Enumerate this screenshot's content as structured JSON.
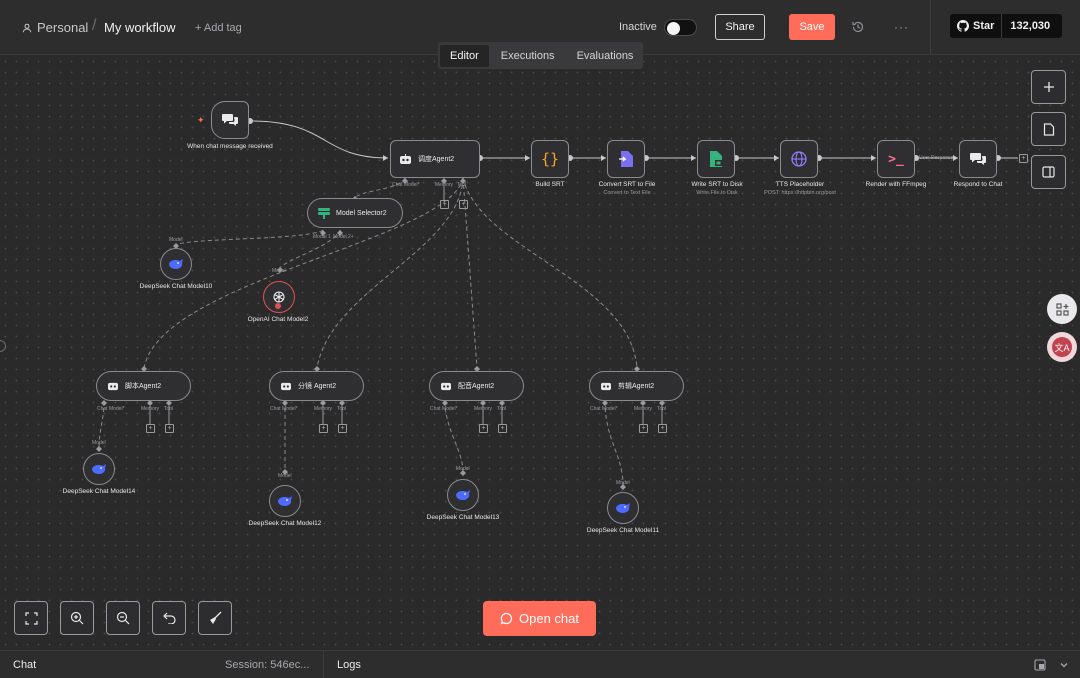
{
  "header": {
    "project": "Personal",
    "separator": "/",
    "workflow_name": "My workflow",
    "add_tag": "+ Add tag",
    "status_label": "Inactive",
    "share_label": "Share",
    "save_label": "Save",
    "more_label": "···",
    "github": {
      "star_label": "Star",
      "star_count": "132,030"
    }
  },
  "tabs": [
    {
      "label": "Editor",
      "active": true
    },
    {
      "label": "Executions",
      "active": false
    },
    {
      "label": "Evaluations",
      "active": false
    }
  ],
  "nodes": {
    "trigger": {
      "label": "When chat message received"
    },
    "main_agent": {
      "label": "调度Agent2",
      "ports": [
        "Chat Model*",
        "Memory",
        "Tool"
      ]
    },
    "build_srt": {
      "label": "Build SRT"
    },
    "convert": {
      "label": "Convert SRT to File",
      "sub": "Convert to Text File"
    },
    "write": {
      "label": "Write SRT to Disk",
      "sub": "Write File to Disk"
    },
    "tts": {
      "label": "TTS Placeholder",
      "sub": "POST: https://httpbin.org/post"
    },
    "render": {
      "label": "Render with FFmpeg"
    },
    "respond": {
      "label": "Respond to Chat",
      "edge_label": "User Response"
    },
    "model_selector": {
      "label": "Model Selector2",
      "ports": [
        "Model 1",
        "Model 2+"
      ]
    },
    "deepseek10": {
      "label": "DeepSeek Chat Model10",
      "port": "Model"
    },
    "openai": {
      "label": "OpenAI Chat Model2",
      "port": "Model"
    },
    "agent_script": {
      "label": "脚本Agent2",
      "ports": [
        "Chat Model*",
        "Memory",
        "Tool"
      ]
    },
    "agent_storyboard": {
      "label": "分镜 Agent2",
      "ports": [
        "Chat Model*",
        "Memory",
        "Tool"
      ]
    },
    "agent_voice": {
      "label": "配音Agent2",
      "ports": [
        "Chat Model*",
        "Memory",
        "Tool"
      ]
    },
    "agent_edit": {
      "label": "剪辑Agent2",
      "ports": [
        "Chat Model*",
        "Memory",
        "Tool"
      ]
    },
    "deepseek14": {
      "label": "DeepSeek Chat Model14",
      "port": "Model"
    },
    "deepseek12": {
      "label": "DeepSeek Chat Model12",
      "port": "Model"
    },
    "deepseek13": {
      "label": "DeepSeek Chat Model13",
      "port": "Model"
    },
    "deepseek11": {
      "label": "DeepSeek Chat Model11",
      "port": "Model"
    }
  },
  "open_chat_label": "Open chat",
  "footer": {
    "chat_label": "Chat",
    "session": "Session: 546ec...",
    "logs_label": "Logs"
  },
  "colors": {
    "accent": "#ff6d5a",
    "canvas": "#2a2a2b",
    "node_border": "#8a8a8f"
  }
}
